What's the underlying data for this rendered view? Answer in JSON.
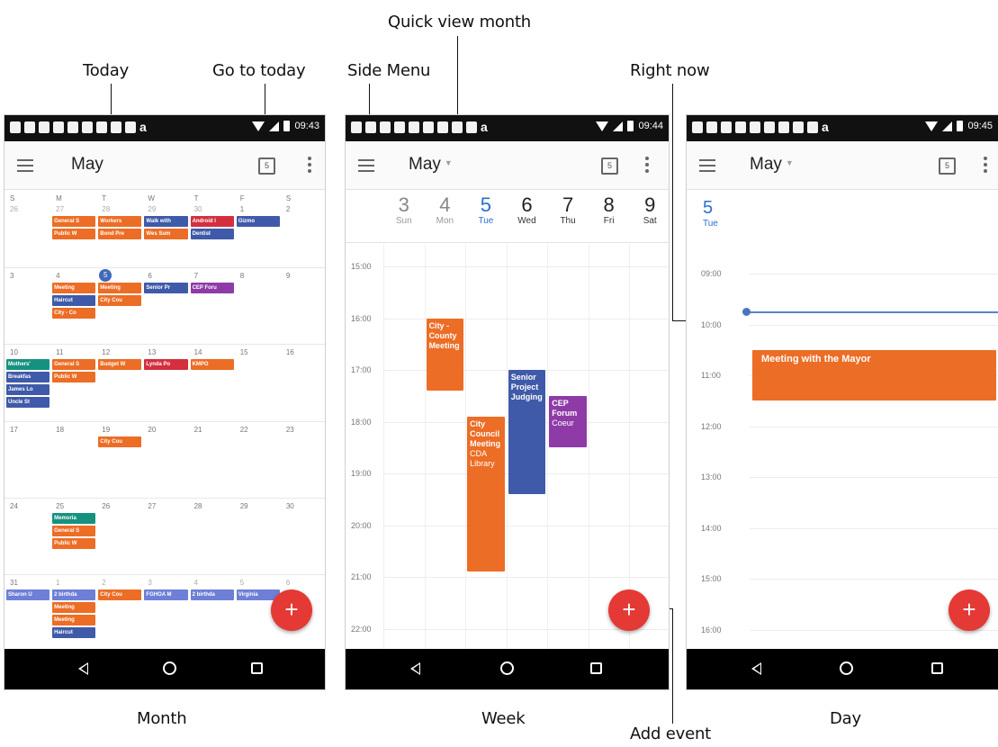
{
  "callouts": {
    "today": "Today",
    "go_to_today": "Go to today",
    "side_menu": "Side Menu",
    "quick_view_month": "Quick view month",
    "right_now": "Right now",
    "add_event": "Add event",
    "month": "Month",
    "week": "Week",
    "day": "Day"
  },
  "colors": {
    "orange": "#ec6d25",
    "blue": "#3f5aa8",
    "red": "#d32f3f",
    "purple": "#8e3ba8",
    "teal": "#15927f",
    "periwinkle": "#6d7fd6",
    "fab": "#e53935",
    "today_blue": "#2a6fd0"
  },
  "status": {
    "icons": [
      "message-icon",
      "notification-icon",
      "twitter-icon",
      "notification-icon",
      "notification-icon",
      "mail-icon",
      "hangouts-icon",
      "photo-icon",
      "upload-icon",
      "amazon-icon"
    ],
    "amazon_glyph": "a"
  },
  "phones": {
    "month": {
      "time": "09:43",
      "title": "May",
      "today_icon_label": "5",
      "fab_label": "+",
      "dow": [
        "S",
        "M",
        "T",
        "W",
        "T",
        "F",
        "S"
      ],
      "weeks": [
        {
          "days": [
            "26",
            "27",
            "28",
            "29",
            "30",
            "1",
            "2"
          ],
          "muted": [
            0,
            1,
            2,
            3,
            4
          ],
          "chips": [
            {
              "col": 1,
              "slot": 0,
              "span": 1,
              "color": "orange",
              "text": "General S"
            },
            {
              "col": 2,
              "slot": 0,
              "span": 1,
              "color": "orange",
              "text": "Workers"
            },
            {
              "col": 3,
              "slot": 0,
              "span": 1,
              "color": "blue",
              "text": "Walk with"
            },
            {
              "col": 4,
              "slot": 0,
              "span": 1,
              "color": "red",
              "text": "Android I"
            },
            {
              "col": 5,
              "slot": 0,
              "span": 1,
              "color": "blue",
              "text": "Gizmo"
            },
            {
              "col": 1,
              "slot": 1,
              "span": 1,
              "color": "orange",
              "text": "Public W"
            },
            {
              "col": 2,
              "slot": 1,
              "span": 1,
              "color": "orange",
              "text": "Bond Pre"
            },
            {
              "col": 3,
              "slot": 1,
              "span": 1,
              "color": "orange",
              "text": "Wes Sum"
            },
            {
              "col": 4,
              "slot": 1,
              "span": 1,
              "color": "blue",
              "text": "Dentist"
            }
          ]
        },
        {
          "days": [
            "3",
            "4",
            "5",
            "6",
            "7",
            "8",
            "9"
          ],
          "muted": [],
          "today_col": 2,
          "chips": [
            {
              "col": 1,
              "slot": 0,
              "span": 1,
              "color": "orange",
              "text": "Meeting"
            },
            {
              "col": 2,
              "slot": 0,
              "span": 1,
              "color": "orange",
              "text": "Meeting"
            },
            {
              "col": 3,
              "slot": 0,
              "span": 1,
              "color": "blue",
              "text": "Senior Pr"
            },
            {
              "col": 4,
              "slot": 0,
              "span": 1,
              "color": "purple",
              "text": "CEP Foru"
            },
            {
              "col": 1,
              "slot": 1,
              "span": 1,
              "color": "blue",
              "text": "Haircut"
            },
            {
              "col": 2,
              "slot": 1,
              "span": 1,
              "color": "orange",
              "text": "City Cou"
            },
            {
              "col": 1,
              "slot": 2,
              "span": 1,
              "color": "orange",
              "text": "City - Co"
            }
          ]
        },
        {
          "days": [
            "10",
            "11",
            "12",
            "13",
            "14",
            "15",
            "16"
          ],
          "muted": [],
          "chips": [
            {
              "col": 0,
              "slot": 0,
              "span": 1,
              "color": "teal",
              "text": "Mothers'"
            },
            {
              "col": 1,
              "slot": 0,
              "span": 1,
              "color": "orange",
              "text": "General S"
            },
            {
              "col": 2,
              "slot": 0,
              "span": 1,
              "color": "orange",
              "text": "Budget W"
            },
            {
              "col": 3,
              "slot": 0,
              "span": 1,
              "color": "red",
              "text": "Lynda Po"
            },
            {
              "col": 4,
              "slot": 0,
              "span": 1,
              "color": "orange",
              "text": "KMPO"
            },
            {
              "col": 0,
              "slot": 1,
              "span": 1,
              "color": "blue",
              "text": "Breakfas"
            },
            {
              "col": 1,
              "slot": 1,
              "span": 1,
              "color": "orange",
              "text": "Public W"
            },
            {
              "col": 0,
              "slot": 2,
              "span": 1,
              "color": "blue",
              "text": "James Lo"
            },
            {
              "col": 0,
              "slot": 3,
              "span": 1,
              "color": "blue",
              "text": "Uncle St"
            }
          ]
        },
        {
          "days": [
            "17",
            "18",
            "19",
            "20",
            "21",
            "22",
            "23"
          ],
          "muted": [],
          "chips": [
            {
              "col": 2,
              "slot": 0,
              "span": 1,
              "color": "orange",
              "text": "City Cou"
            }
          ]
        },
        {
          "days": [
            "24",
            "25",
            "26",
            "27",
            "28",
            "29",
            "30"
          ],
          "muted": [],
          "chips": [
            {
              "col": 1,
              "slot": 0,
              "span": 1,
              "color": "teal",
              "text": "Memoria"
            },
            {
              "col": 1,
              "slot": 1,
              "span": 1,
              "color": "orange",
              "text": "General S"
            },
            {
              "col": 1,
              "slot": 2,
              "span": 1,
              "color": "orange",
              "text": "Public W"
            }
          ]
        },
        {
          "days": [
            "31",
            "1",
            "2",
            "3",
            "4",
            "5",
            "6"
          ],
          "muted": [
            1,
            2,
            3,
            4,
            5,
            6
          ],
          "chips": [
            {
              "col": 0,
              "slot": 0,
              "span": 1,
              "color": "periwinkle",
              "text": "Sharon U"
            },
            {
              "col": 1,
              "slot": 0,
              "span": 1,
              "color": "periwinkle",
              "text": "2 birthda"
            },
            {
              "col": 2,
              "slot": 0,
              "span": 1,
              "color": "orange",
              "text": "City Cou"
            },
            {
              "col": 3,
              "slot": 0,
              "span": 1,
              "color": "periwinkle",
              "text": "FGHOA M"
            },
            {
              "col": 4,
              "slot": 0,
              "span": 1,
              "color": "periwinkle",
              "text": "2 birthda"
            },
            {
              "col": 5,
              "slot": 0,
              "span": 1,
              "color": "periwinkle",
              "text": "Virginia"
            },
            {
              "col": 1,
              "slot": 1,
              "span": 1,
              "color": "orange",
              "text": "Meeting"
            },
            {
              "col": 1,
              "slot": 2,
              "span": 1,
              "color": "orange",
              "text": "Meeting"
            },
            {
              "col": 1,
              "slot": 3,
              "span": 1,
              "color": "blue",
              "text": "Haircut"
            }
          ]
        }
      ]
    },
    "week": {
      "time": "09:44",
      "title": "May",
      "today_icon_label": "5",
      "fab_label": "+",
      "days": [
        {
          "num": "3",
          "name": "Sun",
          "state": "past"
        },
        {
          "num": "4",
          "name": "Mon",
          "state": "past"
        },
        {
          "num": "5",
          "name": "Tue",
          "state": "cur"
        },
        {
          "num": "6",
          "name": "Wed",
          "state": ""
        },
        {
          "num": "7",
          "name": "Thu",
          "state": ""
        },
        {
          "num": "8",
          "name": "Fri",
          "state": ""
        },
        {
          "num": "9",
          "name": "Sat",
          "state": ""
        }
      ],
      "hours": [
        "15:00",
        "16:00",
        "17:00",
        "18:00",
        "19:00",
        "20:00",
        "21:00",
        "22:00"
      ],
      "events": [
        {
          "col": 1,
          "start": 16.0,
          "end": 17.4,
          "color": "orange",
          "text": "City - County Meeting",
          "loc": ""
        },
        {
          "col": 2,
          "start": 17.9,
          "end": 20.9,
          "color": "orange",
          "text": "City Council Meeting",
          "loc": "CDA Library"
        },
        {
          "col": 3,
          "start": 17.0,
          "end": 19.4,
          "color": "blue",
          "text": "Senior Project Judging",
          "loc": ""
        },
        {
          "col": 4,
          "start": 17.5,
          "end": 18.5,
          "color": "purple",
          "text": "CEP Forum",
          "loc": "Coeur"
        }
      ]
    },
    "day": {
      "time": "09:45",
      "title": "May",
      "today_icon_label": "5",
      "fab_label": "+",
      "date_num": "5",
      "date_name": "Tue",
      "hours": [
        "09:00",
        "10:00",
        "11:00",
        "12:00",
        "13:00",
        "14:00",
        "15:00",
        "16:00"
      ],
      "now_hour": 9.75,
      "events": [
        {
          "start": 10.5,
          "end": 11.5,
          "color": "orange",
          "text": "Meeting with the Mayor"
        }
      ]
    }
  }
}
